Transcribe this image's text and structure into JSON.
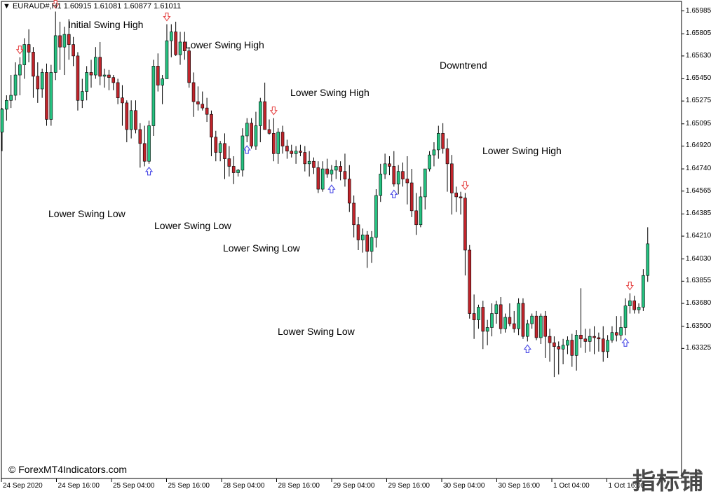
{
  "header": {
    "dropdown_icon": "triangle-down-icon",
    "symbol_line": "EURAUD#,H1  1.60915 1.61081 1.60877 1.61011"
  },
  "copyright": "© ForexMT4Indicators.com",
  "watermark": "指标铺",
  "colors": {
    "bull": "#26c281",
    "bear": "#c0242b",
    "wick": "#000000",
    "swing_high_arrow": "#e64a4a",
    "swing_low_arrow": "#4a4ae6"
  },
  "chart_data": {
    "type": "candlestick",
    "symbol": "EURAUD#",
    "timeframe": "H1",
    "ylim": [
      1.623,
      1.6606
    ],
    "y_ticks": [
      "1.65985",
      "1.65805",
      "1.65630",
      "1.65450",
      "1.65275",
      "1.65095",
      "1.64920",
      "1.64740",
      "1.64565",
      "1.64385",
      "1.64210",
      "1.64030",
      "1.63855",
      "1.63680",
      "1.63500",
      "1.63325"
    ],
    "x_ticks": [
      "24 Sep 2020",
      "24 Sep 16:00",
      "25 Sep 04:00",
      "25 Sep 16:00",
      "28 Sep 04:00",
      "28 Sep 16:00",
      "29 Sep 04:00",
      "29 Sep 16:00",
      "30 Sep 04:00",
      "30 Sep 16:00",
      "1 Oct 04:00",
      "1 Oct 16:00"
    ],
    "candles": [
      [
        1.6503,
        1.6522,
        1.6488,
        1.6521
      ],
      [
        1.6521,
        1.6532,
        1.6512,
        1.6528
      ],
      [
        1.6528,
        1.6548,
        1.6522,
        1.6532
      ],
      [
        1.6532,
        1.6558,
        1.6528,
        1.6548
      ],
      [
        1.6548,
        1.6562,
        1.6532,
        1.6556
      ],
      [
        1.6556,
        1.6577,
        1.6545,
        1.6572
      ],
      [
        1.6572,
        1.6584,
        1.6558,
        1.6566
      ],
      [
        1.6566,
        1.657,
        1.653,
        1.6547
      ],
      [
        1.6547,
        1.6558,
        1.6526,
        1.6537
      ],
      [
        1.6537,
        1.6553,
        1.653,
        1.655
      ],
      [
        1.655,
        1.6557,
        1.6508,
        1.6513
      ],
      [
        1.6513,
        1.6556,
        1.6508,
        1.655
      ],
      [
        1.655,
        1.6598,
        1.6544,
        1.6579
      ],
      [
        1.6579,
        1.659,
        1.6552,
        1.657
      ],
      [
        1.657,
        1.6586,
        1.6548,
        1.658
      ],
      [
        1.658,
        1.6592,
        1.656,
        1.6572
      ],
      [
        1.6572,
        1.6578,
        1.6555,
        1.6563
      ],
      [
        1.6563,
        1.6566,
        1.652,
        1.6528
      ],
      [
        1.6528,
        1.6545,
        1.6522,
        1.6535
      ],
      [
        1.6535,
        1.6555,
        1.6528,
        1.655
      ],
      [
        1.655,
        1.656,
        1.6538,
        1.6548
      ],
      [
        1.6548,
        1.657,
        1.6545,
        1.6562
      ],
      [
        1.6562,
        1.6574,
        1.654,
        1.6547
      ],
      [
        1.6547,
        1.6553,
        1.6538,
        1.6548
      ],
      [
        1.6548,
        1.6552,
        1.6536,
        1.6546
      ],
      [
        1.6546,
        1.6548,
        1.6536,
        1.6542
      ],
      [
        1.6542,
        1.6545,
        1.6525,
        1.653
      ],
      [
        1.653,
        1.654,
        1.6508,
        1.6526
      ],
      [
        1.6526,
        1.6528,
        1.6495,
        1.6505
      ],
      [
        1.6505,
        1.6528,
        1.6498,
        1.652
      ],
      [
        1.652,
        1.6528,
        1.6502,
        1.6505
      ],
      [
        1.6505,
        1.651,
        1.6475,
        1.6494
      ],
      [
        1.6494,
        1.6508,
        1.6476,
        1.648
      ],
      [
        1.648,
        1.6512,
        1.6478,
        1.6508
      ],
      [
        1.6508,
        1.656,
        1.65,
        1.6555
      ],
      [
        1.6555,
        1.6565,
        1.6535,
        1.654
      ],
      [
        1.654,
        1.6548,
        1.6525,
        1.6545
      ],
      [
        1.6545,
        1.6588,
        1.6545,
        1.6575
      ],
      [
        1.6575,
        1.6588,
        1.6562,
        1.6582
      ],
      [
        1.6582,
        1.659,
        1.6563,
        1.6564
      ],
      [
        1.6564,
        1.6582,
        1.6556,
        1.6574
      ],
      [
        1.6574,
        1.6582,
        1.656,
        1.6567
      ],
      [
        1.6567,
        1.657,
        1.6538,
        1.6542
      ],
      [
        1.6542,
        1.655,
        1.6515,
        1.6527
      ],
      [
        1.6527,
        1.6539,
        1.652,
        1.6525
      ],
      [
        1.6525,
        1.6535,
        1.652,
        1.6522
      ],
      [
        1.6522,
        1.653,
        1.6511,
        1.6517
      ],
      [
        1.6517,
        1.652,
        1.6484,
        1.6499
      ],
      [
        1.6499,
        1.6504,
        1.648,
        1.6487
      ],
      [
        1.6487,
        1.6496,
        1.648,
        1.6494
      ],
      [
        1.6494,
        1.6502,
        1.6466,
        1.6482
      ],
      [
        1.6482,
        1.6492,
        1.6468,
        1.6476
      ],
      [
        1.6476,
        1.6484,
        1.6462,
        1.6471
      ],
      [
        1.6471,
        1.6474,
        1.6468,
        1.6473
      ],
      [
        1.6473,
        1.6506,
        1.6468,
        1.65
      ],
      [
        1.65,
        1.6514,
        1.6495,
        1.651
      ],
      [
        1.651,
        1.6514,
        1.649,
        1.6492
      ],
      [
        1.6492,
        1.6519,
        1.6489,
        1.6508
      ],
      [
        1.6508,
        1.653,
        1.6495,
        1.6527
      ],
      [
        1.6527,
        1.6542,
        1.6515,
        1.6505
      ],
      [
        1.6505,
        1.6513,
        1.6501,
        1.6502
      ],
      [
        1.6502,
        1.6514,
        1.648,
        1.6486
      ],
      [
        1.6486,
        1.6506,
        1.6478,
        1.6503
      ],
      [
        1.6503,
        1.6508,
        1.6486,
        1.6492
      ],
      [
        1.6492,
        1.6497,
        1.6482,
        1.6488
      ],
      [
        1.6488,
        1.6493,
        1.6483,
        1.6486
      ],
      [
        1.6486,
        1.6492,
        1.6478,
        1.6488
      ],
      [
        1.6488,
        1.6493,
        1.6484,
        1.6487
      ],
      [
        1.6487,
        1.6492,
        1.6472,
        1.6478
      ],
      [
        1.6478,
        1.6488,
        1.6468,
        1.648
      ],
      [
        1.648,
        1.6483,
        1.647,
        1.6475
      ],
      [
        1.6475,
        1.648,
        1.6455,
        1.6458
      ],
      [
        1.6458,
        1.648,
        1.6456,
        1.6474
      ],
      [
        1.6474,
        1.6482,
        1.6467,
        1.647
      ],
      [
        1.647,
        1.6477,
        1.6464,
        1.6473
      ],
      [
        1.6473,
        1.6481,
        1.6466,
        1.6476
      ],
      [
        1.6476,
        1.648,
        1.6465,
        1.6472
      ],
      [
        1.6472,
        1.6486,
        1.646,
        1.6466
      ],
      [
        1.6466,
        1.6477,
        1.644,
        1.6447
      ],
      [
        1.6447,
        1.6453,
        1.642,
        1.643
      ],
      [
        1.643,
        1.6436,
        1.641,
        1.6418
      ],
      [
        1.6418,
        1.6427,
        1.6408,
        1.6422
      ],
      [
        1.6422,
        1.6425,
        1.6396,
        1.6409
      ],
      [
        1.6409,
        1.6425,
        1.64,
        1.642
      ],
      [
        1.642,
        1.6458,
        1.6412,
        1.6453
      ],
      [
        1.6453,
        1.6478,
        1.6448,
        1.647
      ],
      [
        1.647,
        1.6486,
        1.6466,
        1.6478
      ],
      [
        1.6478,
        1.6484,
        1.6469,
        1.6476
      ],
      [
        1.6476,
        1.6488,
        1.646,
        1.6462
      ],
      [
        1.6462,
        1.6477,
        1.6454,
        1.6472
      ],
      [
        1.6472,
        1.6479,
        1.646,
        1.6466
      ],
      [
        1.6466,
        1.6484,
        1.6446,
        1.6463
      ],
      [
        1.6463,
        1.6474,
        1.6436,
        1.6441
      ],
      [
        1.6441,
        1.6455,
        1.6422,
        1.643
      ],
      [
        1.643,
        1.646,
        1.6428,
        1.6452
      ],
      [
        1.6452,
        1.647,
        1.6442,
        1.6474
      ],
      [
        1.6474,
        1.6488,
        1.6472,
        1.6485
      ],
      [
        1.6485,
        1.6495,
        1.6476,
        1.6489
      ],
      [
        1.6489,
        1.6508,
        1.6482,
        1.6502
      ],
      [
        1.6502,
        1.651,
        1.6486,
        1.649
      ],
      [
        1.649,
        1.6498,
        1.6456,
        1.6478
      ],
      [
        1.6478,
        1.6485,
        1.6438,
        1.6455
      ],
      [
        1.6455,
        1.646,
        1.644,
        1.6452
      ],
      [
        1.6452,
        1.6456,
        1.6438,
        1.6451
      ],
      [
        1.6451,
        1.6455,
        1.639,
        1.641
      ],
      [
        1.641,
        1.6414,
        1.6356,
        1.636
      ],
      [
        1.636,
        1.6375,
        1.634,
        1.6355
      ],
      [
        1.6355,
        1.6367,
        1.6348,
        1.6365
      ],
      [
        1.6365,
        1.637,
        1.6332,
        1.6346
      ],
      [
        1.6346,
        1.6355,
        1.6335,
        1.6349
      ],
      [
        1.6349,
        1.6368,
        1.6342,
        1.636
      ],
      [
        1.636,
        1.637,
        1.6352,
        1.6367
      ],
      [
        1.6367,
        1.6373,
        1.6344,
        1.6348
      ],
      [
        1.6348,
        1.636,
        1.6345,
        1.6357
      ],
      [
        1.6357,
        1.6368,
        1.635,
        1.6352
      ],
      [
        1.6352,
        1.6362,
        1.6345,
        1.6348
      ],
      [
        1.6348,
        1.6372,
        1.6343,
        1.6368
      ],
      [
        1.6368,
        1.6372,
        1.634,
        1.6342
      ],
      [
        1.6342,
        1.6355,
        1.6338,
        1.6352
      ],
      [
        1.6352,
        1.636,
        1.6348,
        1.6358
      ],
      [
        1.6358,
        1.6362,
        1.6339,
        1.6341
      ],
      [
        1.6341,
        1.636,
        1.6336,
        1.6358
      ],
      [
        1.6358,
        1.6362,
        1.6325,
        1.6342
      ],
      [
        1.6342,
        1.6348,
        1.6322,
        1.6337
      ],
      [
        1.6337,
        1.6342,
        1.631,
        1.6334
      ],
      [
        1.6334,
        1.6338,
        1.6312,
        1.6332
      ],
      [
        1.6332,
        1.634,
        1.632,
        1.6335
      ],
      [
        1.6335,
        1.6342,
        1.6328,
        1.6339
      ],
      [
        1.6339,
        1.6344,
        1.6318,
        1.6327
      ],
      [
        1.6327,
        1.6347,
        1.6315,
        1.6343
      ],
      [
        1.6343,
        1.638,
        1.6333,
        1.634
      ],
      [
        1.634,
        1.6348,
        1.6329,
        1.6338
      ],
      [
        1.6338,
        1.6348,
        1.633,
        1.6342
      ],
      [
        1.6342,
        1.635,
        1.6328,
        1.6341
      ],
      [
        1.6341,
        1.6345,
        1.633,
        1.634
      ],
      [
        1.634,
        1.635,
        1.6322,
        1.633
      ],
      [
        1.633,
        1.6343,
        1.6325,
        1.6339
      ],
      [
        1.6339,
        1.635,
        1.6337,
        1.6345
      ],
      [
        1.6345,
        1.6358,
        1.6338,
        1.6343
      ],
      [
        1.6343,
        1.6358,
        1.6339,
        1.6349
      ],
      [
        1.6349,
        1.6372,
        1.6343,
        1.6366
      ],
      [
        1.6366,
        1.6376,
        1.636,
        1.637
      ],
      [
        1.637,
        1.6374,
        1.636,
        1.6363
      ],
      [
        1.6363,
        1.6368,
        1.636,
        1.6365
      ],
      [
        1.6365,
        1.6395,
        1.6362,
        1.639
      ],
      [
        1.639,
        1.6428,
        1.6385,
        1.6415
      ]
    ],
    "annotations": [
      {
        "text": "Initial Swing High",
        "color_key": "swing_high_arrow"
      },
      {
        "text": "Lower Swing High"
      },
      {
        "text": "Lower Swing High"
      },
      {
        "text": "Lower Swing High"
      },
      {
        "text": "Lower Swing Low"
      },
      {
        "text": "Lower Swing Low"
      },
      {
        "text": "Lower Swing Low"
      },
      {
        "text": "Lower Swing Low"
      },
      {
        "text": "Downtrend"
      }
    ],
    "swing_high_bars": [
      4,
      12,
      37,
      61,
      104,
      141,
      148,
      153
    ],
    "swing_low_bars": [
      33,
      55,
      74,
      88,
      118,
      140
    ]
  }
}
